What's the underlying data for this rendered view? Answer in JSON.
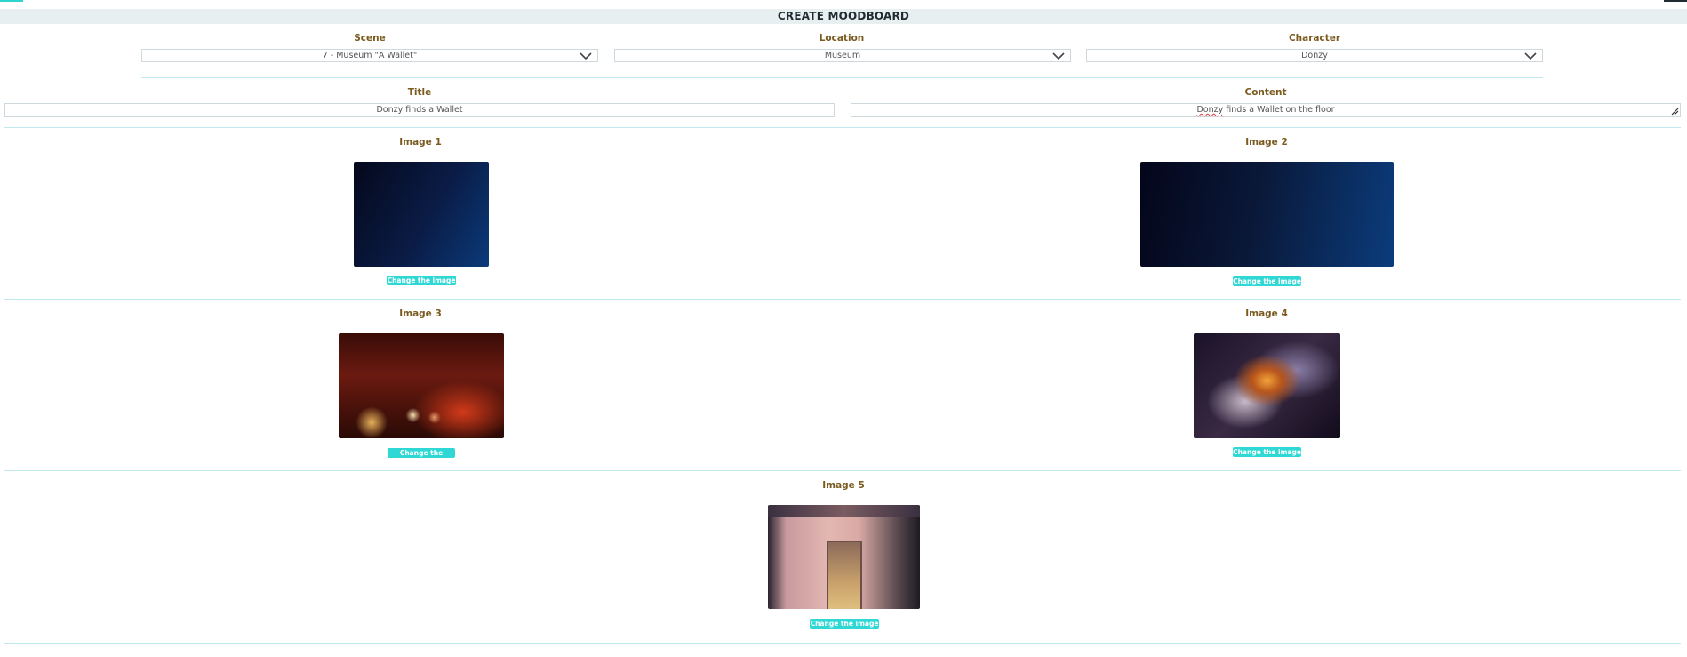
{
  "page": {
    "title": "CREATE MOODBOARD"
  },
  "filters": {
    "scene": {
      "label": "Scene",
      "value": "7 - Museum \"A Wallet\""
    },
    "location": {
      "label": "Location",
      "value": "Museum"
    },
    "character": {
      "label": "Character",
      "value": "Donzy"
    }
  },
  "fields": {
    "title": {
      "label": "Title",
      "value": "Donzy finds a Wallet"
    },
    "content": {
      "label": "Content",
      "value_word1": "Donzy",
      "value_rest": " finds a Wallet on the floor"
    }
  },
  "images": [
    {
      "label": "Image 1",
      "button": "Change the image"
    },
    {
      "label": "Image 2",
      "button": "Change the image"
    },
    {
      "label": "Image 3",
      "button": "Change the image"
    },
    {
      "label": "Image 4",
      "button": "Change the image"
    },
    {
      "label": "Image 5",
      "button": "Change the image"
    }
  ],
  "colors": {
    "accent": "#2fd8d4",
    "label": "#7a5a1e",
    "divider": "#bfe9ee"
  }
}
